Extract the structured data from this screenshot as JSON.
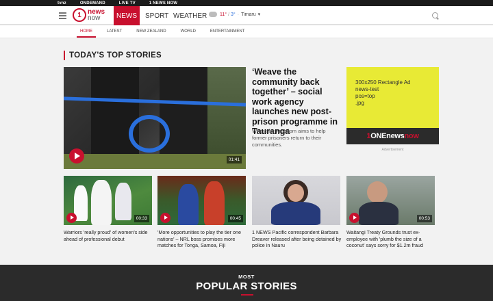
{
  "topbar": {
    "links": [
      "tvnz",
      "ONDEMAND",
      "LIVE TV",
      "1 NEWS NOW"
    ]
  },
  "header": {
    "logo_number": "1",
    "logo_line1": "news",
    "logo_line2": "now",
    "nav": [
      "NEWS",
      "SPORT",
      "WEATHER"
    ],
    "weather_high": "11°",
    "weather_sep": "/",
    "weather_low": "3°",
    "weather_city": "Timaru",
    "weather_caret": "▾"
  },
  "subnav": [
    "HOME",
    "LATEST",
    "NEW ZEALAND",
    "WORLD",
    "ENTERTAINMENT"
  ],
  "main": {
    "section_title": "TODAY'S TOP STORIES",
    "hero": {
      "headline": "‘Weave the community back together’ – social work agency launches new post-prison programme in Tauranga",
      "summary": "Whare for Freedom aims to help former prisoners return to their communities.",
      "duration": "01:41"
    },
    "ad": {
      "text": "300x250 Rectangle Ad\nnews-test\npos=top\n.jpg",
      "brand_prefix": "1",
      "brand_main": "ONEnews",
      "brand_suffix": "now",
      "label": "Advertisement"
    },
    "cards": [
      {
        "caption": "Warriors 'really proud' of women's side ahead of professional debut",
        "duration": "00:33",
        "video": true
      },
      {
        "caption": "'More opportunities to play the tier one nations' – NRL boss promises more matches for Tonga, Samoa, Fiji",
        "duration": "00:45",
        "video": true
      },
      {
        "caption": "1 NEWS Pacific correspondent Barbara Dreaver released after being detained by police in Nauru",
        "duration": "",
        "video": false
      },
      {
        "caption": "Waitangi Treaty Grounds trust ex-employee with 'plumb the size of a coconut' says sorry for $1.2m fraud",
        "duration": "00:53",
        "video": true
      }
    ]
  },
  "popular": {
    "kicker": "MOST",
    "title": "POPULAR STORIES"
  },
  "colors": {
    "brand_red": "#c8102e",
    "dark": "#2b2b2b",
    "ad_yellow": "#e8ea35"
  }
}
